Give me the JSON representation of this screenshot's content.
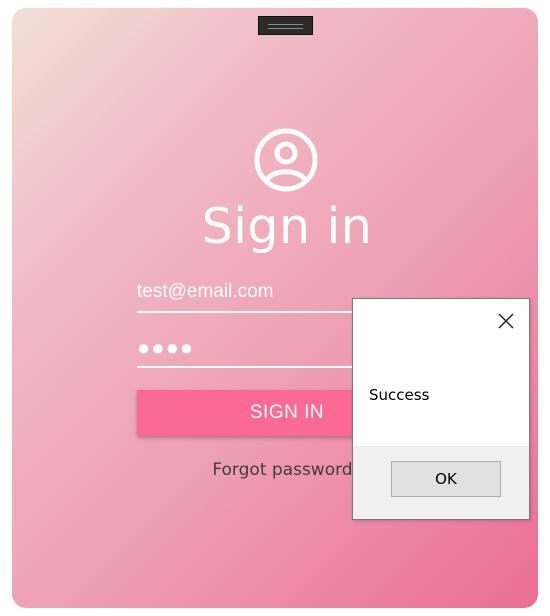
{
  "login": {
    "title": "Sign in",
    "user_icon": "user-circle-icon",
    "email_value": "test@email.com",
    "password_value": "●●●●",
    "signin_label": "SIGN IN",
    "forgot_label": "Forgot password?"
  },
  "dialog": {
    "message": "Success",
    "ok_label": "OK",
    "close_icon": "close-icon"
  },
  "colors": {
    "gradient_start": "#f2dfd7",
    "gradient_end": "#eb6d94",
    "button": "#fb6996",
    "text_light": "#ffffff",
    "link_text": "#3d3d3d"
  }
}
